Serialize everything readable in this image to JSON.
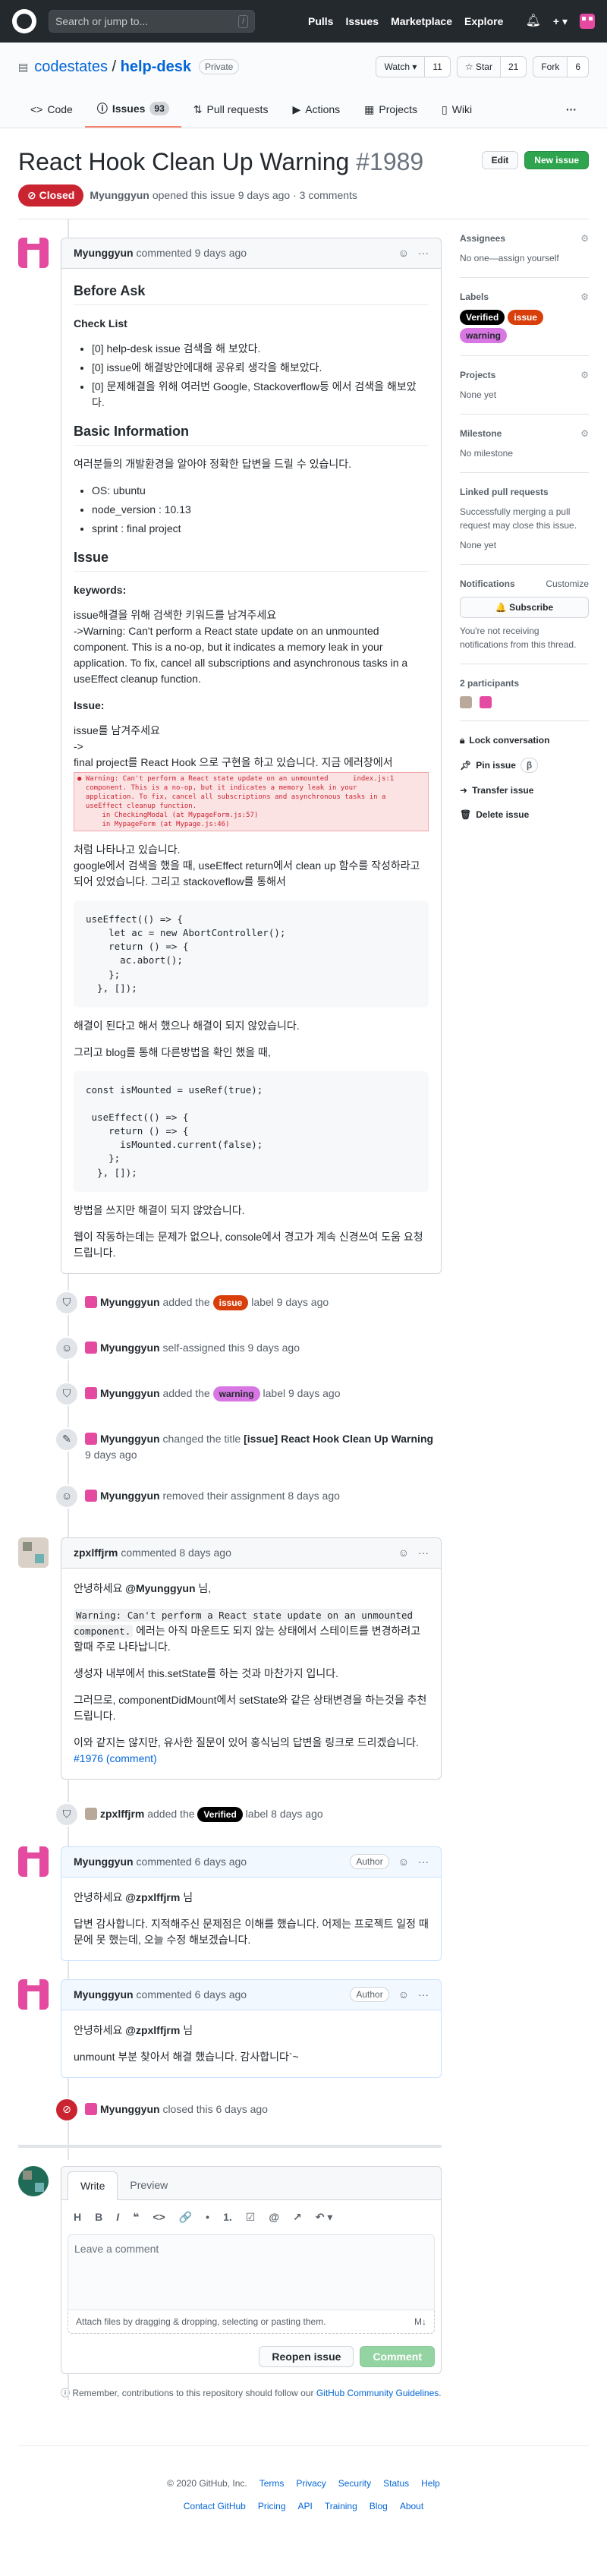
{
  "header": {
    "search_placeholder": "Search or jump to...",
    "slash": "/",
    "nav": [
      "Pulls",
      "Issues",
      "Marketplace",
      "Explore"
    ],
    "plus": "+ ▾"
  },
  "repo": {
    "owner": "codestates",
    "sep": " / ",
    "name": "help-desk",
    "visibility": "Private",
    "watch": {
      "label": "Watch ▾",
      "count": "11"
    },
    "star": {
      "label": "☆ Star",
      "count": "21"
    },
    "fork": {
      "label": "Fork",
      "count": "6"
    }
  },
  "tabs": [
    {
      "label": "Code",
      "icon": "code-icon"
    },
    {
      "label": "Issues",
      "count": "93",
      "icon": "issue-icon"
    },
    {
      "label": "Pull requests",
      "icon": "pull-request-icon"
    },
    {
      "label": "Actions",
      "icon": "actions-icon"
    },
    {
      "label": "Projects",
      "icon": "projects-icon"
    },
    {
      "label": "Wiki",
      "icon": "wiki-icon"
    }
  ],
  "issue": {
    "title": "React Hook Clean Up Warning",
    "number": "#1989",
    "edit": "Edit",
    "new": "New issue",
    "state": "Closed",
    "author": "Myunggyun",
    "meta": "opened this issue 9 days ago · 3 comments"
  },
  "c1": {
    "author": "Myunggyun",
    "time": "commented 9 days ago",
    "h_before": "Before Ask",
    "h_check": "Check List",
    "checks": [
      "[0] help-desk issue 검색을 해 보았다.",
      "[0] issue에 해결방안에대해 공유뢰 생각을 해보았다.",
      "[0] 문제해결을 위해 여러번 Google, Stackoverflow등 에서 검색을 해보았다."
    ],
    "h_basic": "Basic Information",
    "basic_intro": "여러분들의 개발환경을 알아야 정확한 답변을 드릴 수 있습니다.",
    "basic": [
      "OS: ubuntu",
      "node_version : 10.13",
      "sprint : final project"
    ],
    "h_issue": "Issue",
    "h_keywords": "keywords:",
    "kw_intro": "issue해결을 위해 검색한 키워드를 남겨주세요",
    "kw_text": "->Warning: Can't perform a React state update on an unmounted component. This is a no-op, but it indicates a memory leak in your application. To fix, cancel all subscriptions and asynchronous tasks in a useEffect cleanup function.",
    "h_issue2": "Issue:",
    "issue_intro": "issue를 남겨주세요",
    "arrow": "->",
    "final": "final project를 React Hook 으로 구현을 하고 있습니다. 지금 에러창에서",
    "error": "● Warning: Can't perform a React state update on an unmounted      index.js:1\n  component. This is a no-op, but it indicates a memory leak in your\n  application. To fix, cancel all subscriptions and asynchronous tasks in a\n  useEffect cleanup function.\n      in CheckingModal (at MypageForm.js:57)\n      in MypageForm (at Mypage.js:46)",
    "p1": "처럼 나타나고 있습니다.",
    "p2": "google에서 검색을 했을 때, useEffect return에서 clean up 함수를 작성하라고 되어 있었습니다. 그리고 stackoveflow를 통해서",
    "code1": "useEffect(() => {\n    let ac = new AbortController();\n    return () => {\n      ac.abort();\n    };\n  }, []);",
    "p3": "해결이 된다고 해서 했으나 해결이 되지 않았습니다.",
    "p4": "그리고 blog를 통해 다른방법을 확인 했을 때,",
    "code2": "const isMounted = useRef(true);\n\n useEffect(() => {\n    return () => {\n      isMounted.current(false);\n    };\n  }, []);",
    "p5": "방법을 쓰지만 해결이 되지 않았습니다.",
    "p6": "웹이 작동하는데는 문제가 없으나, console에서 경고가 계속 신경쓰여 도움 요청 드립니다."
  },
  "events": [
    {
      "icon": "tag-icon",
      "actor": "Myunggyun",
      "pre": "added the",
      "label": "issue",
      "post": "label 9 days ago"
    },
    {
      "icon": "person-icon",
      "actor": "Myunggyun",
      "pre": "self-assigned this 9 days ago"
    },
    {
      "icon": "tag-icon",
      "actor": "Myunggyun",
      "pre": "added the",
      "label": "warning",
      "post": "label 9 days ago"
    },
    {
      "icon": "pencil-icon",
      "actor": "Myunggyun",
      "pre": "changed the title",
      "old": "[issue] React Hook Clean Up Warning",
      "post": "9 days ago"
    },
    {
      "icon": "person-icon",
      "actor": "Myunggyun",
      "pre": "removed their assignment 8 days ago"
    }
  ],
  "c2": {
    "author": "zpxlffjrm",
    "time": "commented 8 days ago",
    "greet": "안녕하세요",
    "mention": "@Myunggyun",
    "greet2": "님,",
    "warn": "Warning: Can't perform a React state update on an unmounted component.",
    "p1b": "에러는 아직 마운트도 되지 않는 상태에서 스테이트를 변경하려고 할때 주로 나타납니다.",
    "p2": "생성자 내부에서 this.setState를 하는 것과 마찬가지 입니다.",
    "p3": "그러므로, componentDidMount에서 setState와 같은 상태변경을 하는것을 추천드립니다.",
    "p4": "이와 같지는 않지만, 유사한 질문이 있어 홍식님의 답변을 링크로 드리겠습니다.",
    "link": "#1976 (comment)"
  },
  "ev_verified": {
    "actor": "zpxlffjrm",
    "pre": "added the",
    "label": "Verified",
    "post": "label 8 days ago"
  },
  "c3": {
    "author": "Myunggyun",
    "time": "commented 6 days ago",
    "badge": "Author",
    "greet": "안녕하세요",
    "mention": "@zpxlffjrm",
    "greet2": "님",
    "p": "답변 감사합니다. 지적해주신 문제점은 이해를 했습니다. 어제는 프로젝트 일정 때문에 못 했는데, 오늘 수정 해보겠습니다."
  },
  "c4": {
    "author": "Myunggyun",
    "time": "commented 6 days ago",
    "badge": "Author",
    "greet": "안녕하세요",
    "mention": "@zpxlffjrm",
    "greet2": "님",
    "p": "unmount 부분 찾아서 해결 했습니다. 감사합니다`~"
  },
  "ev_closed": {
    "actor": "Myunggyun",
    "text": "closed this 6 days ago"
  },
  "editor": {
    "write": "Write",
    "preview": "Preview",
    "tools": [
      "H",
      "B",
      "I",
      "❝",
      "<>",
      "🔗",
      "•",
      "1.",
      "☑",
      "@",
      "↗",
      "↶ ▾"
    ],
    "placeholder": "Leave a comment",
    "attach": "Attach files by dragging & dropping, selecting or pasting them.",
    "md": "M↓",
    "reopen": "Reopen issue",
    "comment": "Comment"
  },
  "guide": {
    "pre": "Remember, contributions to this repository should follow our",
    "link": "GitHub Community Guidelines",
    "post": "."
  },
  "sidebar": {
    "assignees": {
      "title": "Assignees",
      "value": "No one—assign yourself"
    },
    "labels": {
      "title": "Labels",
      "items": [
        "Verified",
        "issue",
        "warning"
      ]
    },
    "projects": {
      "title": "Projects",
      "value": "None yet"
    },
    "milestone": {
      "title": "Milestone",
      "value": "No milestone"
    },
    "linked": {
      "title": "Linked pull requests",
      "desc": "Successfully merging a pull request may close this issue.",
      "value": "None yet"
    },
    "notifications": {
      "title": "Notifications",
      "customize": "Customize",
      "button": "🔔 Subscribe",
      "desc": "You're not receiving notifications from this thread."
    },
    "participants": {
      "title": "2 participants"
    },
    "actions": [
      "Lock conversation",
      "Pin issue",
      "Transfer issue",
      "Delete issue"
    ],
    "pin_beta": "β"
  },
  "footer": {
    "copyright": "© 2020 GitHub, Inc.",
    "row1": [
      "Terms",
      "Privacy",
      "Security",
      "Status",
      "Help"
    ],
    "row2": [
      "Contact GitHub",
      "Pricing",
      "API",
      "Training",
      "Blog",
      "About"
    ]
  },
  "colors": {
    "closed": "#cb2431",
    "green": "#2ea44f",
    "issue_label": "#d93f0b",
    "warning_label": "#d876e3",
    "verified_label": "#000000"
  }
}
